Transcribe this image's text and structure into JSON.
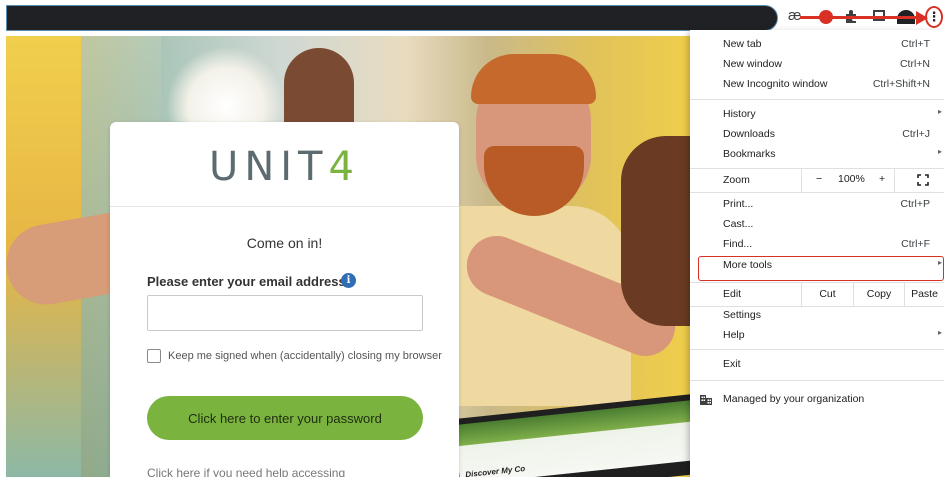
{
  "toolbar": {
    "extension_text": "æ",
    "annotation_number": "1",
    "kebab_glyph": "⋮"
  },
  "card": {
    "logo_main": "UNIT",
    "logo_accent": "4",
    "greeting": "Come on in!",
    "email_label": "Please enter your email address:",
    "email_value": "",
    "remember_label": "Keep me signed when (accidentally) closing my browser",
    "password_button": "Click here to enter your password",
    "help_link": "Click here if you need help accessing",
    "brand_color": "#7ab33e"
  },
  "laptop": {
    "screen_text": "Discover My Co"
  },
  "menu": {
    "new_tab": {
      "label": "New tab",
      "shortcut": "Ctrl+T"
    },
    "new_window": {
      "label": "New window",
      "shortcut": "Ctrl+N"
    },
    "new_incognito": {
      "label": "New Incognito window",
      "shortcut": "Ctrl+Shift+N"
    },
    "history": {
      "label": "History"
    },
    "downloads": {
      "label": "Downloads",
      "shortcut": "Ctrl+J"
    },
    "bookmarks": {
      "label": "Bookmarks"
    },
    "zoom": {
      "label": "Zoom",
      "minus": "−",
      "value": "100%",
      "plus": "+"
    },
    "print": {
      "label": "Print...",
      "shortcut": "Ctrl+P"
    },
    "cast": {
      "label": "Cast..."
    },
    "find": {
      "label": "Find...",
      "shortcut": "Ctrl+F"
    },
    "more_tools": {
      "label": "More tools"
    },
    "edit": {
      "label": "Edit",
      "cut": "Cut",
      "copy": "Copy",
      "paste": "Paste"
    },
    "settings": {
      "label": "Settings"
    },
    "help": {
      "label": "Help"
    },
    "exit": {
      "label": "Exit"
    },
    "managed": {
      "label": "Managed by your organization"
    },
    "highlight_color": "#d93025"
  }
}
